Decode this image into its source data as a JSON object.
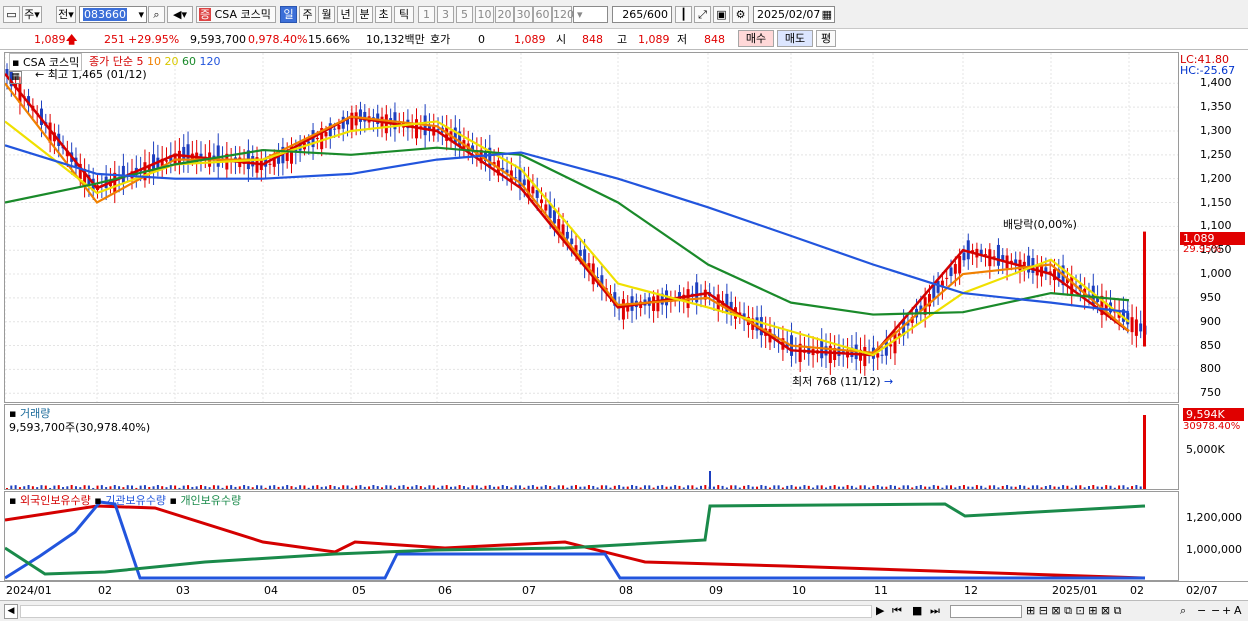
{
  "toolbar": {
    "mode": "주",
    "prev": "전",
    "code": "083660",
    "name_badge": "증",
    "name": "CSA 코스믹",
    "periods": [
      "일",
      "주",
      "월",
      "년",
      "분",
      "초",
      "틱"
    ],
    "selected_period": "일",
    "minute_periods": [
      "1",
      "3",
      "5",
      "10",
      "20",
      "30",
      "60",
      "120"
    ],
    "count": "265",
    "count_total": "/600",
    "date": "2025/02/07"
  },
  "quote": {
    "price": "1,089",
    "change": "251",
    "change_pct": "+29.95%",
    "volume": "9,593,700",
    "volume_ratio": "0,978.40%",
    "turnover": "15.66%",
    "amount": "10,132백만",
    "hoga_label": "호가",
    "hoga_value": "0",
    "hoga_price": "1,089",
    "open_label": "시",
    "open": "848",
    "high_label": "고",
    "high": "1,089",
    "low_label": "저",
    "low": "848",
    "buy": "매수",
    "sell": "매도",
    "avg": "평"
  },
  "price_panel": {
    "title": "CSA 코스믹",
    "ma_label": "종가 단순",
    "ma_periods": [
      "5",
      "10",
      "20",
      "60",
      "120"
    ],
    "ma_colors": [
      "#d40000",
      "#f08000",
      "#f0e000",
      "#1a8a2a",
      "#2255dd"
    ],
    "high_note": "최고 1,465 (01/12)",
    "low_note": "최저 768 (11/12)",
    "dividend_note": "배당락(0,00%)",
    "lc": "LC:41.80",
    "hc": "HC:-25.67",
    "last_price_tag": "1,089",
    "last_pct_tag": "29.95%",
    "y_ticks": [
      "1,400",
      "1,350",
      "1,300",
      "1,250",
      "1,200",
      "1,150",
      "1,100",
      "1,050",
      "1,000",
      "950",
      "900",
      "850",
      "800",
      "750"
    ]
  },
  "volume_panel": {
    "title": "거래량",
    "value": "9,593,700주(30,978.40%)",
    "tag": "9,594K",
    "tag2": "30978.40%",
    "y_tick": "5,000K"
  },
  "holding_panel": {
    "legend": [
      {
        "label": "외국인보유수량",
        "color": "#d40000"
      },
      {
        "label": "기관보유수량",
        "color": "#2255dd"
      },
      {
        "label": "개인보유수량",
        "color": "#1a8a4a"
      }
    ],
    "y_ticks": [
      "1,200,000",
      "1,000,000"
    ]
  },
  "x_axis": {
    "labels": [
      "2024/01",
      "02",
      "03",
      "04",
      "05",
      "06",
      "07",
      "08",
      "09",
      "10",
      "11",
      "12",
      "2025/01",
      "02"
    ],
    "last_date": "02/07"
  },
  "chart_data": {
    "type": "line",
    "title": "CSA 코스믹",
    "x": [
      "2024/01",
      "02",
      "03",
      "04",
      "05",
      "06",
      "07",
      "08",
      "09",
      "10",
      "11",
      "12",
      "2025/01",
      "02"
    ],
    "series": [
      {
        "name": "5",
        "values": [
          1420,
          1180,
          1250,
          1230,
          1330,
          1300,
          1180,
          930,
          960,
          840,
          830,
          1050,
          1000,
          880
        ]
      },
      {
        "name": "10",
        "values": [
          1400,
          1150,
          1240,
          1240,
          1330,
          1310,
          1190,
          935,
          950,
          850,
          835,
          1000,
          1020,
          880
        ]
      },
      {
        "name": "20",
        "values": [
          1320,
          1170,
          1230,
          1240,
          1300,
          1320,
          1220,
          980,
          930,
          880,
          830,
          960,
          1030,
          900
        ]
      },
      {
        "name": "60",
        "values": [
          1150,
          1190,
          1230,
          1260,
          1250,
          1265,
          1250,
          1150,
          1020,
          940,
          915,
          920,
          960,
          945
        ]
      },
      {
        "name": "120",
        "values": [
          1270,
          1210,
          1200,
          1200,
          1210,
          1240,
          1255,
          1200,
          1140,
          1080,
          1020,
          960,
          940,
          920
        ]
      }
    ],
    "ylim": [
      740,
      1430
    ]
  }
}
